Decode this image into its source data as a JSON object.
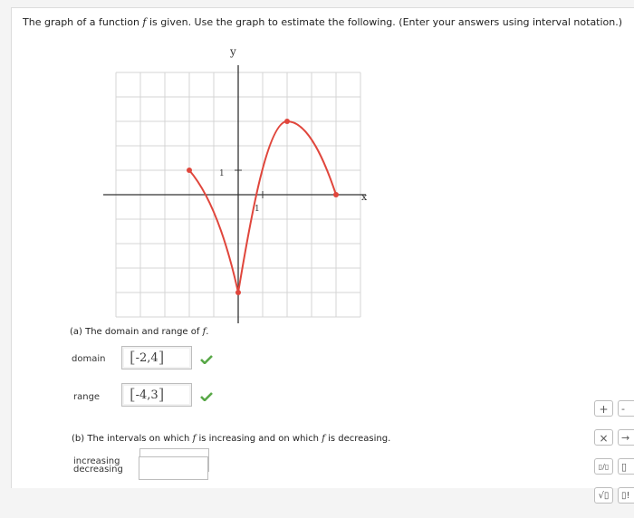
{
  "prompt": {
    "before_f": "The graph of a function ",
    "f": "f",
    "after_f": " is given. Use the graph to estimate the following. (Enter your answers using interval notation.)"
  },
  "graph": {
    "y_axis_label": "y",
    "x_axis_label": "x",
    "y_tick_label": "1",
    "x_tick_label": "1",
    "curve_color": "#e0463c",
    "grid_color": "#d4d4d4",
    "points": [
      [
        -2,
        1
      ],
      [
        0,
        -4
      ],
      [
        2,
        3
      ],
      [
        4,
        0
      ]
    ]
  },
  "part_a": {
    "title": "(a) The domain and range of f.",
    "domain_label": "domain",
    "domain_value": "-2,4",
    "range_label": "range",
    "range_value": "-4,3"
  },
  "part_b": {
    "title": "(b) The intervals on which f is increasing and on which f is decreasing.",
    "increasing_label": "increasing",
    "increasing_value": "",
    "decreasing_label": "decreasing",
    "decreasing_value": ""
  },
  "palette": {
    "plus": "+",
    "times": "×",
    "fraction": "▯/▯",
    "sqrt": "√▯",
    "minus_partial": "-",
    "arrow_partial": "→",
    "box_partial": "▯",
    "box2_partial": "▯!"
  },
  "colors": {
    "check": "#59a848",
    "accent": "#e0463c"
  }
}
